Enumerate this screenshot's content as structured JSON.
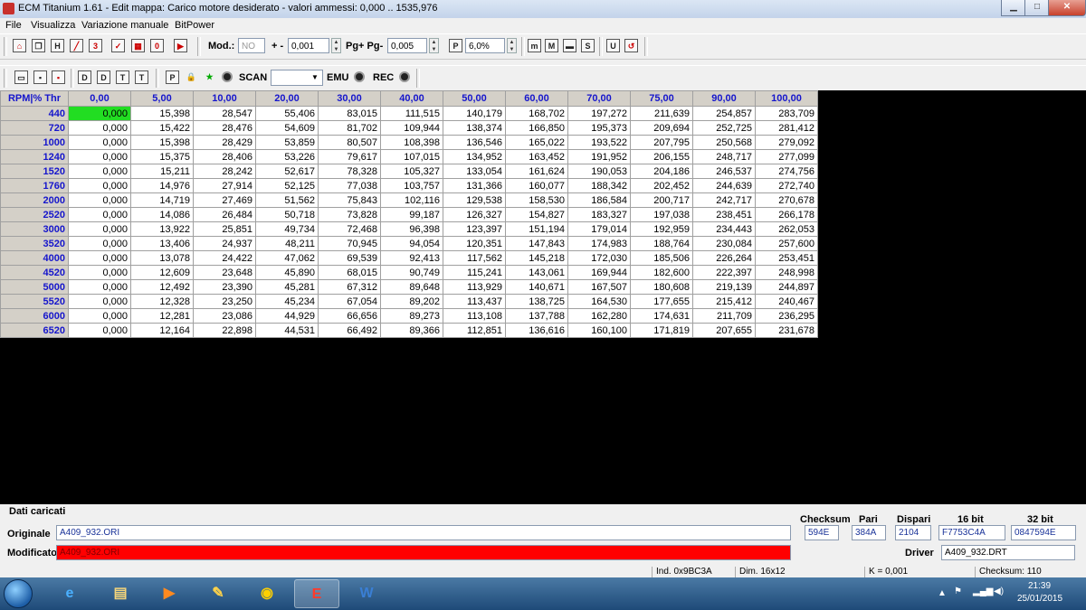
{
  "window": {
    "title": "ECM Titanium 1.61 - Edit mappa: Carico motore desiderato - valori ammessi: 0,000 .. 1535,976",
    "minimize": "▁",
    "maximize": "□",
    "close": "✕"
  },
  "menu": [
    "File",
    "Visualizza",
    "Variazione manuale",
    "BitPower"
  ],
  "toolbar1": {
    "mod_label": "Mod.:",
    "mod_value": "NO",
    "step_label": "+ -",
    "step_value": "0,001",
    "pg_label": "Pg+ Pg-",
    "pg_value": "0,005",
    "pct_icon": "P",
    "pct_value": "6,0%"
  },
  "toolbar2": {
    "scan_label": "SCAN",
    "scan_value": "",
    "emu_label": "EMU",
    "rec_label": "REC"
  },
  "grid": {
    "corner": "RPM|% Thr",
    "columns": [
      "0,00",
      "5,00",
      "10,00",
      "20,00",
      "30,00",
      "40,00",
      "50,00",
      "60,00",
      "70,00",
      "75,00",
      "90,00",
      "100,00"
    ],
    "rows": [
      {
        "rpm": "440",
        "values": [
          "0,000",
          "15,398",
          "28,547",
          "55,406",
          "83,015",
          "111,515",
          "140,179",
          "168,702",
          "197,272",
          "211,639",
          "254,857",
          "283,709"
        ]
      },
      {
        "rpm": "720",
        "values": [
          "0,000",
          "15,422",
          "28,476",
          "54,609",
          "81,702",
          "109,944",
          "138,374",
          "166,850",
          "195,373",
          "209,694",
          "252,725",
          "281,412"
        ]
      },
      {
        "rpm": "1000",
        "values": [
          "0,000",
          "15,398",
          "28,429",
          "53,859",
          "80,507",
          "108,398",
          "136,546",
          "165,022",
          "193,522",
          "207,795",
          "250,568",
          "279,092"
        ]
      },
      {
        "rpm": "1240",
        "values": [
          "0,000",
          "15,375",
          "28,406",
          "53,226",
          "79,617",
          "107,015",
          "134,952",
          "163,452",
          "191,952",
          "206,155",
          "248,717",
          "277,099"
        ]
      },
      {
        "rpm": "1520",
        "values": [
          "0,000",
          "15,211",
          "28,242",
          "52,617",
          "78,328",
          "105,327",
          "133,054",
          "161,624",
          "190,053",
          "204,186",
          "246,537",
          "274,756"
        ]
      },
      {
        "rpm": "1760",
        "values": [
          "0,000",
          "14,976",
          "27,914",
          "52,125",
          "77,038",
          "103,757",
          "131,366",
          "160,077",
          "188,342",
          "202,452",
          "244,639",
          "272,740"
        ]
      },
      {
        "rpm": "2000",
        "values": [
          "0,000",
          "14,719",
          "27,469",
          "51,562",
          "75,843",
          "102,116",
          "129,538",
          "158,530",
          "186,584",
          "200,717",
          "242,717",
          "270,678"
        ]
      },
      {
        "rpm": "2520",
        "values": [
          "0,000",
          "14,086",
          "26,484",
          "50,718",
          "73,828",
          "99,187",
          "126,327",
          "154,827",
          "183,327",
          "197,038",
          "238,451",
          "266,178"
        ]
      },
      {
        "rpm": "3000",
        "values": [
          "0,000",
          "13,922",
          "25,851",
          "49,734",
          "72,468",
          "96,398",
          "123,397",
          "151,194",
          "179,014",
          "192,959",
          "234,443",
          "262,053"
        ]
      },
      {
        "rpm": "3520",
        "values": [
          "0,000",
          "13,406",
          "24,937",
          "48,211",
          "70,945",
          "94,054",
          "120,351",
          "147,843",
          "174,983",
          "188,764",
          "230,084",
          "257,600"
        ]
      },
      {
        "rpm": "4000",
        "values": [
          "0,000",
          "13,078",
          "24,422",
          "47,062",
          "69,539",
          "92,413",
          "117,562",
          "145,218",
          "172,030",
          "185,506",
          "226,264",
          "253,451"
        ]
      },
      {
        "rpm": "4520",
        "values": [
          "0,000",
          "12,609",
          "23,648",
          "45,890",
          "68,015",
          "90,749",
          "115,241",
          "143,061",
          "169,944",
          "182,600",
          "222,397",
          "248,998"
        ]
      },
      {
        "rpm": "5000",
        "values": [
          "0,000",
          "12,492",
          "23,390",
          "45,281",
          "67,312",
          "89,648",
          "113,929",
          "140,671",
          "167,507",
          "180,608",
          "219,139",
          "244,897"
        ]
      },
      {
        "rpm": "5520",
        "values": [
          "0,000",
          "12,328",
          "23,250",
          "45,234",
          "67,054",
          "89,202",
          "113,437",
          "138,725",
          "164,530",
          "177,655",
          "215,412",
          "240,467"
        ]
      },
      {
        "rpm": "6000",
        "values": [
          "0,000",
          "12,281",
          "23,086",
          "44,929",
          "66,656",
          "89,273",
          "113,108",
          "137,788",
          "162,280",
          "174,631",
          "211,709",
          "236,295"
        ]
      },
      {
        "rpm": "6520",
        "values": [
          "0,000",
          "12,164",
          "22,898",
          "44,531",
          "66,492",
          "89,366",
          "112,851",
          "136,616",
          "160,100",
          "171,819",
          "207,655",
          "231,678"
        ]
      }
    ]
  },
  "bottom": {
    "section_label": "Dati caricati",
    "originale_label": "Originale",
    "originale_value": "A409_932.ORI",
    "modificato_label": "Modificato",
    "modificato_value": "A409_932.ORI",
    "checksum_label": "Checksum",
    "checksum_value": "594E",
    "pari_label": "Pari",
    "pari_value": "384A",
    "dispari_label": "Dispari",
    "dispari_value": "2104",
    "bit16_label": "16 bit",
    "bit16_value": "F7753C4A",
    "bit32_label": "32 bit",
    "bit32_value": "0847594E",
    "driver_label": "Driver",
    "driver_value": "A409_932.DRT"
  },
  "status": {
    "ind": "Ind. 0x9BC3A",
    "dim": "Dim. 16x12",
    "k": "K = 0,001",
    "checksum": "Checksum: 110"
  },
  "taskbar": {
    "time": "21:39",
    "date": "25/01/2015"
  },
  "colors": {
    "selected_cell": "#22dd22",
    "modified_field": "#ff0000",
    "header_text": "#1515cc"
  }
}
